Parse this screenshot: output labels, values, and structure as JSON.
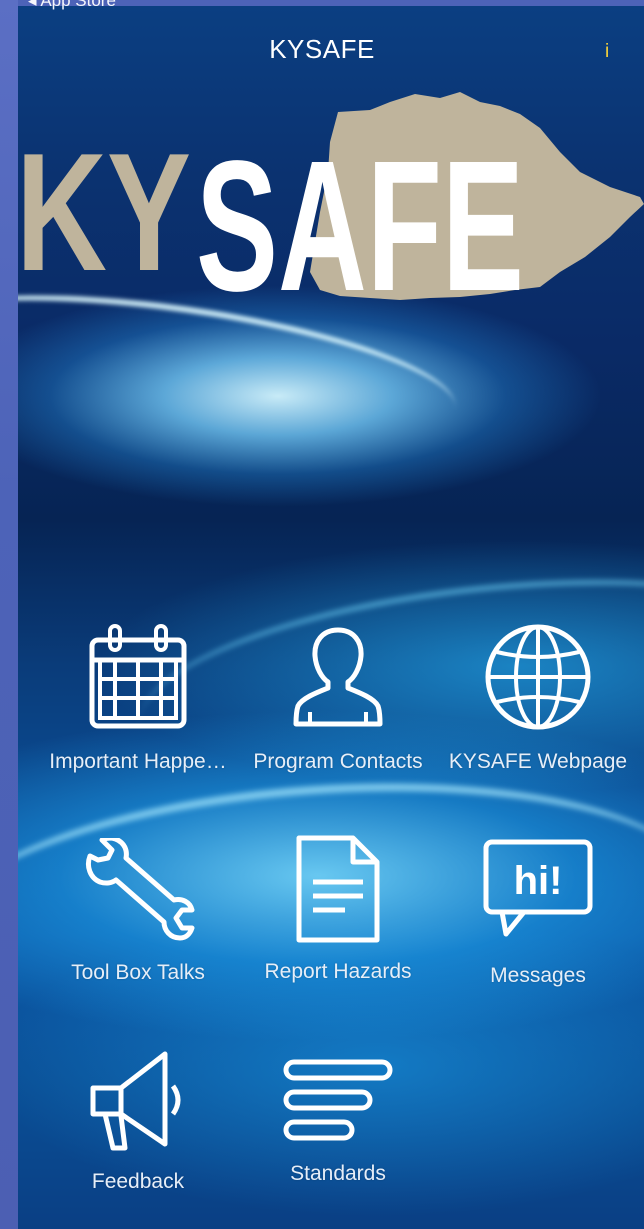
{
  "status_bar": {
    "back_label": "◂ App Store"
  },
  "nav": {
    "title": "KYSAFE",
    "info_label": "i"
  },
  "logo": {
    "text_ky": "KY",
    "text_safe": "SAFE"
  },
  "grid": {
    "items": [
      {
        "label": "Important Happe…",
        "icon": "calendar-icon"
      },
      {
        "label": "Program Contacts",
        "icon": "person-icon"
      },
      {
        "label": "KYSAFE Webpage",
        "icon": "globe-icon"
      },
      {
        "label": "Tool Box Talks",
        "icon": "wrench-icon"
      },
      {
        "label": "Report Hazards",
        "icon": "document-icon"
      },
      {
        "label": "Messages",
        "icon": "chat-bubble-icon"
      },
      {
        "label": "Feedback",
        "icon": "megaphone-icon"
      },
      {
        "label": "Standards",
        "icon": "lines-icon"
      }
    ]
  },
  "colors": {
    "info_accent": "#f7d23a",
    "logo_tan": "#bfb49c",
    "icon_stroke": "#ffffff"
  }
}
